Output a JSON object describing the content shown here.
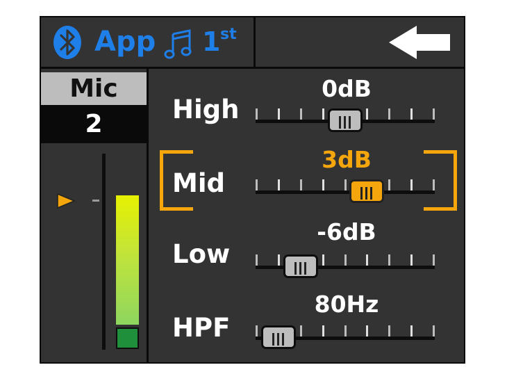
{
  "header": {
    "bluetooth_icon": "bluetooth-icon",
    "source_label": "App",
    "music_icon": "music-note-icon",
    "track_number": "1",
    "track_suffix": "st",
    "back_icon": "back-arrow-icon",
    "accent_color": "#1f7fe8"
  },
  "channel": {
    "name": "Mic",
    "number": "2",
    "meter_level": 0.66,
    "meter_pointer_icon": "triangle-pointer-icon"
  },
  "eq": {
    "bands": [
      {
        "label": "High",
        "value": "0dB",
        "position": 0.5
      },
      {
        "label": "Mid",
        "value": "3dB",
        "position": 0.625,
        "selected": true
      },
      {
        "label": "Low",
        "value": "-6dB",
        "position": 0.25
      },
      {
        "label": "HPF",
        "value": "80Hz",
        "position": 0.125
      }
    ],
    "selected_color": "#f5a60c"
  }
}
